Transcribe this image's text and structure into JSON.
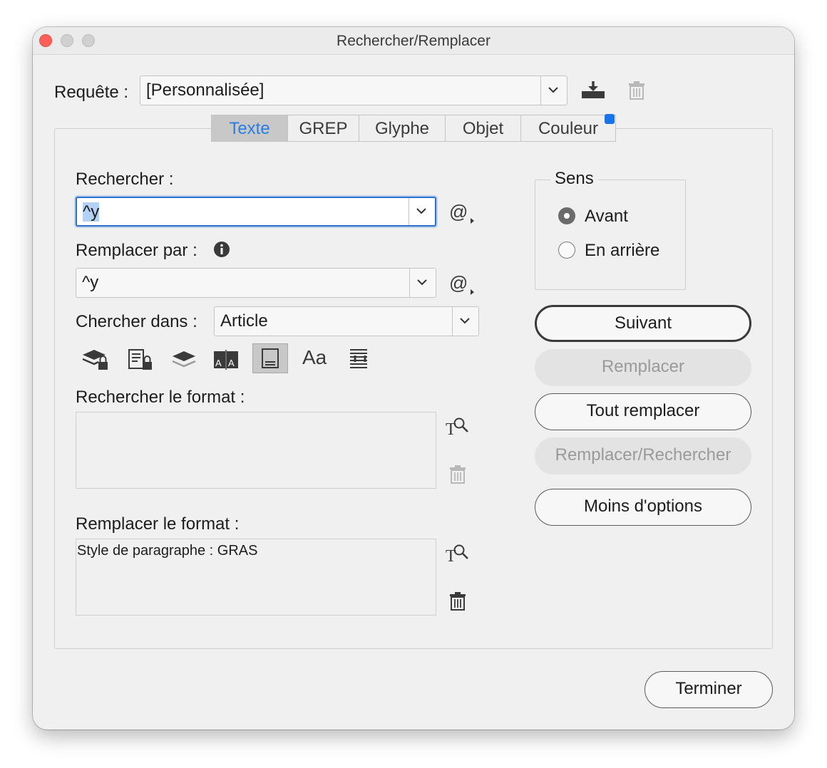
{
  "window": {
    "title": "Rechercher/Remplacer"
  },
  "query": {
    "label": "Requête :",
    "value": "[Personnalisée]"
  },
  "tabs": [
    {
      "label": "Texte",
      "active": true
    },
    {
      "label": "GREP",
      "active": false
    },
    {
      "label": "Glyphe",
      "active": false
    },
    {
      "label": "Objet",
      "active": false
    },
    {
      "label": "Couleur",
      "active": false
    }
  ],
  "find": {
    "label": "Rechercher :",
    "value": "^y"
  },
  "replace": {
    "label": "Remplacer par :",
    "value": "^y"
  },
  "search_in": {
    "label": "Chercher dans :",
    "value": "Article"
  },
  "find_format": {
    "label": "Rechercher le format :",
    "value": ""
  },
  "replace_format": {
    "label": "Remplacer le format :",
    "value": "Style de paragraphe : GRAS"
  },
  "direction": {
    "legend": "Sens",
    "options": [
      {
        "label": "Avant",
        "selected": true
      },
      {
        "label": "En arrière",
        "selected": false
      }
    ]
  },
  "buttons": {
    "next": "Suivant",
    "replace": "Remplacer",
    "replace_all": "Tout remplacer",
    "replace_find": "Remplacer/Rechercher",
    "fewer_options": "Moins d'options",
    "done": "Terminer"
  },
  "option_icons": [
    "locked-layers-icon",
    "locked-stories-icon",
    "hidden-layers-icon",
    "master-pages-icon",
    "footnotes-icon",
    "case-sensitive-icon",
    "whole-word-icon"
  ],
  "case_sensitive_glyph": "Aa",
  "colors": {
    "accent": "#2a7de1",
    "focus": "#2a71d0",
    "close": "#ff5f57"
  }
}
